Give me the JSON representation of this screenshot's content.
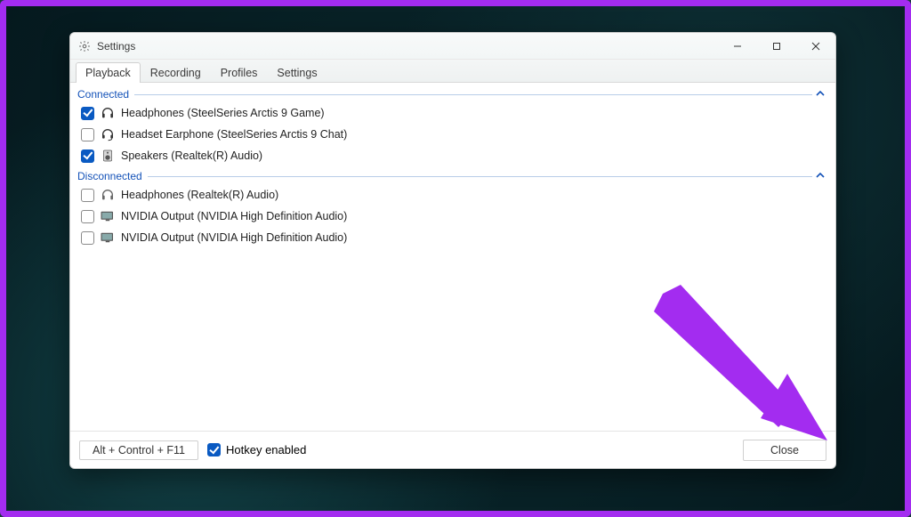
{
  "window": {
    "title": "Settings"
  },
  "tabs": [
    {
      "label": "Playback",
      "active": true
    },
    {
      "label": "Recording",
      "active": false
    },
    {
      "label": "Profiles",
      "active": false
    },
    {
      "label": "Settings",
      "active": false
    }
  ],
  "sections": {
    "connected": {
      "label": "Connected",
      "devices": [
        {
          "label": "Headphones (SteelSeries Arctis 9 Game)",
          "checked": true,
          "icon": "headphones"
        },
        {
          "label": "Headset Earphone (SteelSeries Arctis 9 Chat)",
          "checked": false,
          "icon": "headset"
        },
        {
          "label": "Speakers (Realtek(R) Audio)",
          "checked": true,
          "icon": "speaker"
        }
      ]
    },
    "disconnected": {
      "label": "Disconnected",
      "devices": [
        {
          "label": "Headphones (Realtek(R) Audio)",
          "checked": false,
          "icon": "headphones"
        },
        {
          "label": "NVIDIA Output (NVIDIA High Definition Audio)",
          "checked": false,
          "icon": "monitor"
        },
        {
          "label": "NVIDIA Output (NVIDIA High Definition Audio)",
          "checked": false,
          "icon": "monitor"
        }
      ]
    }
  },
  "footer": {
    "hotkey_text": "Alt + Control + F11",
    "hotkey_enabled_label": "Hotkey enabled",
    "hotkey_enabled_checked": true,
    "close_label": "Close"
  },
  "colors": {
    "accent_purple": "#a32cf0",
    "link_blue": "#1452b8",
    "check_blue": "#0a5ac2"
  }
}
